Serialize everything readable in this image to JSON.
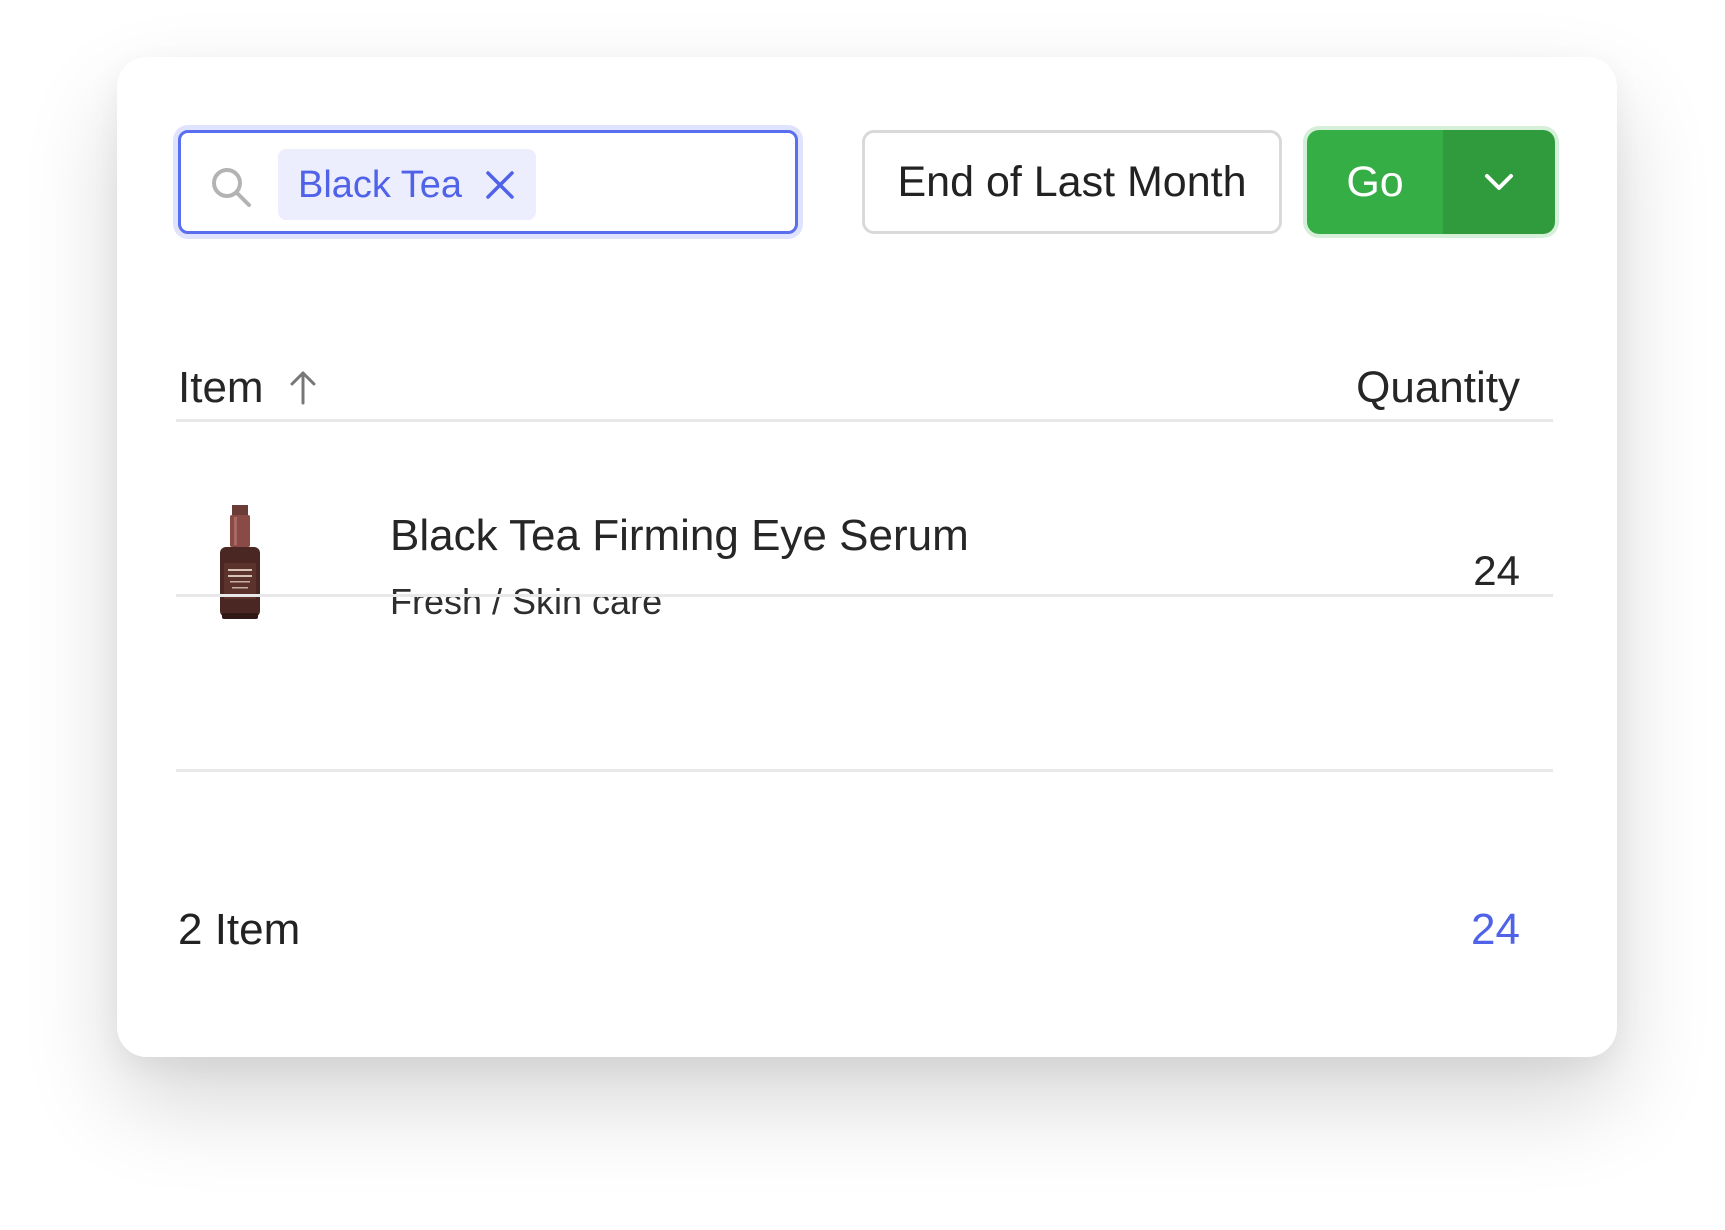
{
  "search": {
    "chip_label": "Black Tea"
  },
  "date_filter": {
    "label": "End of Last Month"
  },
  "go": {
    "label": "Go"
  },
  "table": {
    "columns": [
      "Item",
      "Quantity"
    ],
    "sort": "ascending",
    "rows": [
      {
        "name": "Black Tea Firming Eye Serum",
        "category": "Fresh / Skin care",
        "quantity": "24"
      }
    ]
  },
  "footer": {
    "count_label": "2 Item",
    "total": "24"
  },
  "colors": {
    "accent": "#4f62e8",
    "go_green": "#36ae46",
    "go_green_dark": "#2f9b3d"
  }
}
